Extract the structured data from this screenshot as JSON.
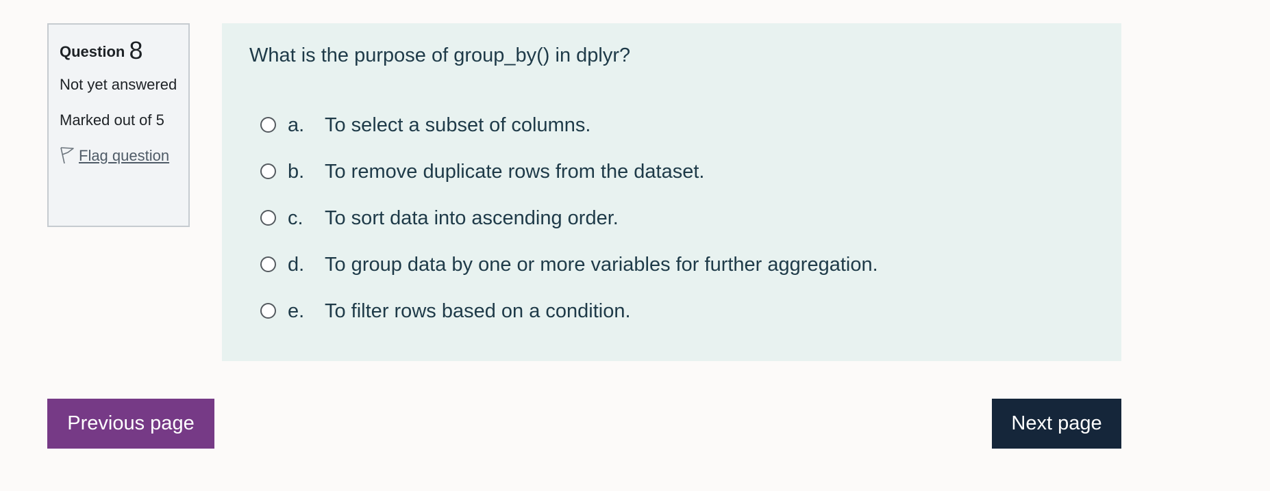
{
  "question_info": {
    "label": "Question",
    "number": "8",
    "state": "Not yet answered",
    "grade": "Marked out of 5",
    "flag_label": "Flag question",
    "flag_icon": "flag-icon"
  },
  "question": {
    "text": "What is the purpose of group_by() in dplyr?",
    "answers": [
      {
        "letter": "a.",
        "text": "To select a subset of columns."
      },
      {
        "letter": "b.",
        "text": "To remove duplicate rows from the dataset."
      },
      {
        "letter": "c.",
        "text": "To sort data into ascending order."
      },
      {
        "letter": "d.",
        "text": "To group data by one or more variables for further aggregation."
      },
      {
        "letter": "e.",
        "text": "To filter rows based on a condition."
      }
    ]
  },
  "navigation": {
    "previous_label": "Previous page",
    "next_label": "Next page"
  },
  "colors": {
    "previous_button": "#763a86",
    "next_button": "#15263a",
    "content_background": "#e8f2f0",
    "info_background": "#f2f4f6"
  }
}
